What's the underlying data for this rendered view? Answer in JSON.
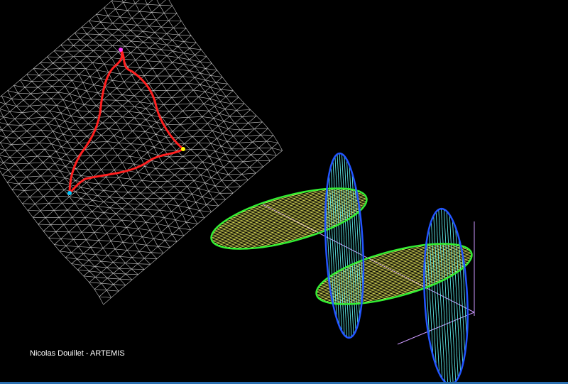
{
  "credit": "Nicolas Douillet - ARTEMIS",
  "colors": {
    "background": "#000000",
    "mesh": "#e8e8e8",
    "path": "#ff2020",
    "vertex_start": "#ff40ff",
    "vertex_right": "#ffff00",
    "vertex_left": "#00c8ff",
    "ellipse_green": "#33ee33",
    "ellipse_blue": "#2255ff",
    "hatch_yellow": "#ffff66",
    "hatch_cyan": "#66ffff",
    "axis": "#cc99ff"
  }
}
